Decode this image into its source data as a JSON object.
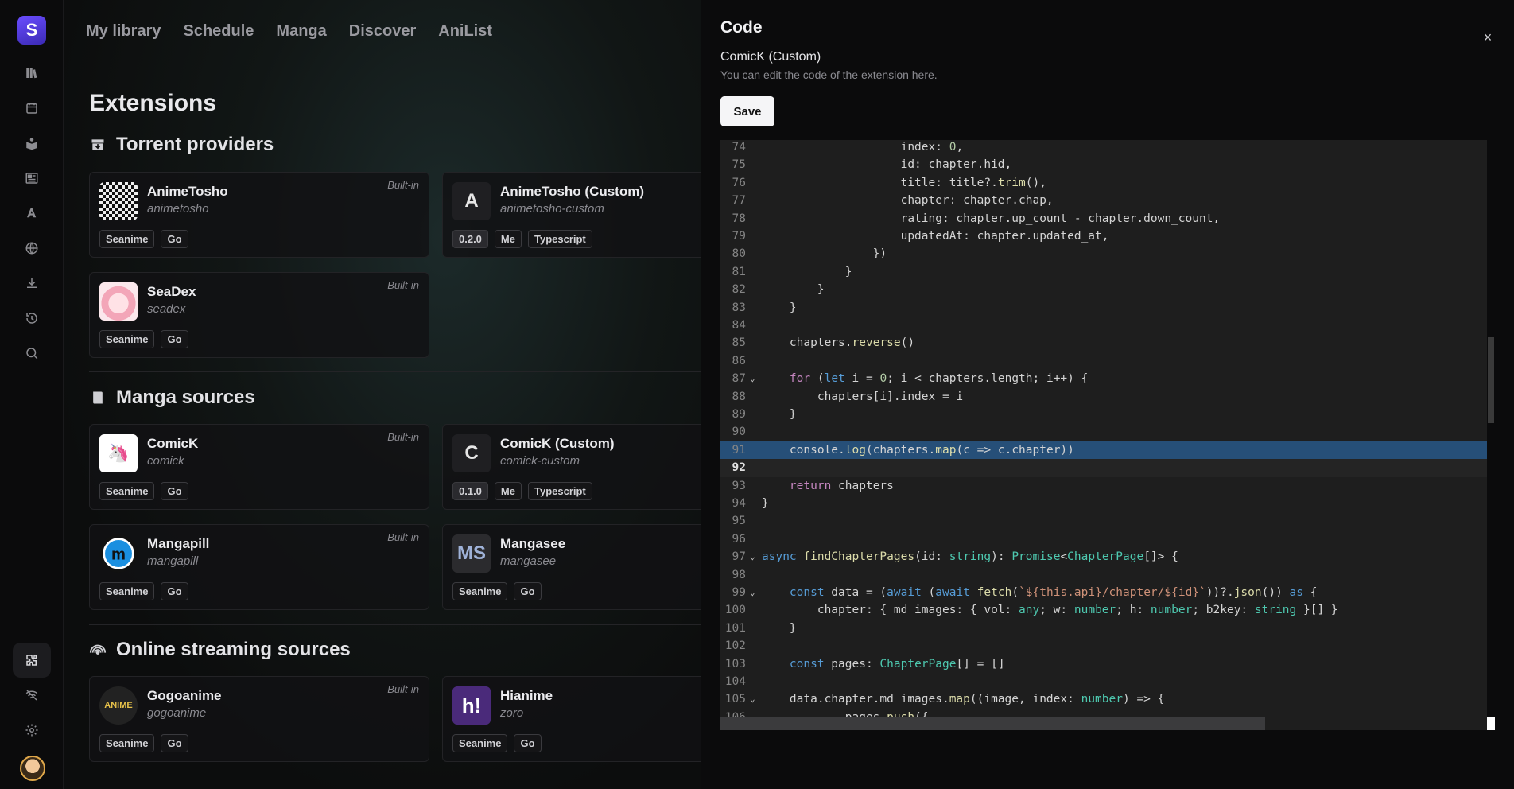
{
  "app": {
    "logo_letter": "S"
  },
  "sidebar": {
    "icons": [
      "library-icon",
      "calendar-icon",
      "manga-icon",
      "news-icon",
      "anilist-icon",
      "discover-icon",
      "download-icon",
      "history-icon",
      "search-icon",
      "extensions-icon",
      "offline-icon",
      "settings-icon"
    ],
    "active": "extensions-icon"
  },
  "topnav": [
    "My library",
    "Schedule",
    "Manga",
    "Discover",
    "AniList"
  ],
  "page": {
    "title": "Extensions"
  },
  "sections": {
    "torrent": {
      "title": "Torrent providers",
      "cards": [
        {
          "name": "AnimeTosho",
          "slug": "animetosho",
          "builtin": "Built-in",
          "tags": [
            "Seanime",
            "Go"
          ]
        },
        {
          "name": "AnimeTosho (Custom)",
          "slug": "animetosho-custom",
          "letter": "A",
          "tags": [
            "0.2.0",
            "Me",
            "Typescript"
          ]
        },
        {
          "name": "SeaDex",
          "slug": "seadex",
          "builtin": "Built-in",
          "tags": [
            "Seanime",
            "Go"
          ]
        }
      ]
    },
    "manga": {
      "title": "Manga sources",
      "cards": [
        {
          "name": "ComicK",
          "slug": "comick",
          "builtin": "Built-in",
          "tags": [
            "Seanime",
            "Go"
          ]
        },
        {
          "name": "ComicK (Custom)",
          "slug": "comick-custom",
          "letter": "C",
          "tags": [
            "0.1.0",
            "Me",
            "Typescript"
          ]
        },
        {
          "name": "Mangapill",
          "slug": "mangapill",
          "builtin": "Built-in",
          "tags": [
            "Seanime",
            "Go"
          ]
        },
        {
          "name": "Mangasee",
          "slug": "mangasee",
          "logo_text": "MS",
          "tags": [
            "Seanime",
            "Go"
          ]
        }
      ]
    },
    "streaming": {
      "title": "Online streaming sources",
      "cards": [
        {
          "name": "Gogoanime",
          "slug": "gogoanime",
          "builtin": "Built-in",
          "tags": [
            "Seanime",
            "Go"
          ]
        },
        {
          "name": "Hianime",
          "slug": "zoro",
          "logo_text": "h!",
          "tags": [
            "Seanime",
            "Go"
          ]
        }
      ]
    }
  },
  "drawer": {
    "title": "Code",
    "close": "×",
    "extension_name": "ComicK (Custom)",
    "description": "You can edit the code of the extension here.",
    "save_label": "Save",
    "highlight_line": 91,
    "cursor_line": 92,
    "code": [
      {
        "n": 74,
        "t": "                    index: 0,"
      },
      {
        "n": 75,
        "t": "                    id: chapter.hid,"
      },
      {
        "n": 76,
        "t": "                    title: title?.trim(),"
      },
      {
        "n": 77,
        "t": "                    chapter: chapter.chap,"
      },
      {
        "n": 78,
        "t": "                    rating: chapter.up_count - chapter.down_count,"
      },
      {
        "n": 79,
        "t": "                    updatedAt: chapter.updated_at,"
      },
      {
        "n": 80,
        "t": "                })"
      },
      {
        "n": 81,
        "t": "            }"
      },
      {
        "n": 82,
        "t": "        }"
      },
      {
        "n": 83,
        "t": "    }"
      },
      {
        "n": 84,
        "t": ""
      },
      {
        "n": 85,
        "t": "    chapters.reverse()"
      },
      {
        "n": 86,
        "t": ""
      },
      {
        "n": 87,
        "t": "    for (let i = 0; i < chapters.length; i++) {",
        "fold": true
      },
      {
        "n": 88,
        "t": "        chapters[i].index = i"
      },
      {
        "n": 89,
        "t": "    }"
      },
      {
        "n": 90,
        "t": ""
      },
      {
        "n": 91,
        "t": "    console.log(chapters.map(c => c.chapter))"
      },
      {
        "n": 92,
        "t": ""
      },
      {
        "n": 93,
        "t": "    return chapters"
      },
      {
        "n": 94,
        "t": "}"
      },
      {
        "n": 95,
        "t": ""
      },
      {
        "n": 96,
        "t": ""
      },
      {
        "n": 97,
        "t": "async findChapterPages(id: string): Promise<ChapterPage[]> {",
        "fold": true
      },
      {
        "n": 98,
        "t": ""
      },
      {
        "n": 99,
        "t": "    const data = (await (await fetch(`${this.api}/chapter/${id}`))?.json()) as {",
        "fold": true
      },
      {
        "n": 100,
        "t": "        chapter: { md_images: { vol: any; w: number; h: number; b2key: string }[] }"
      },
      {
        "n": 101,
        "t": "    }"
      },
      {
        "n": 102,
        "t": ""
      },
      {
        "n": 103,
        "t": "    const pages: ChapterPage[] = []"
      },
      {
        "n": 104,
        "t": ""
      },
      {
        "n": 105,
        "t": "    data.chapter.md_images.map((image, index: number) => {",
        "fold": true
      },
      {
        "n": 106,
        "t": "            pages.push({"
      }
    ]
  }
}
